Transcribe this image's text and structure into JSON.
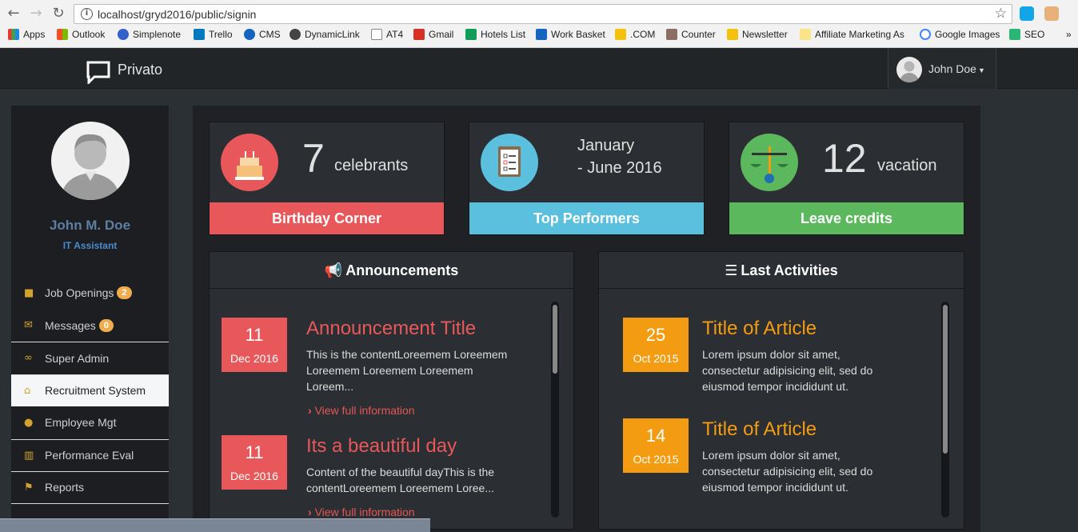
{
  "browser": {
    "url": "localhost/gryd2016/public/signin",
    "bookmarks": [
      "Apps",
      "Outlook",
      "Simplenote",
      "Trello",
      "CMS",
      "DynamicLink",
      "AT4",
      "Gmail",
      "Hotels List",
      "Work Basket",
      ".COM",
      "Counter",
      "Newsletter",
      "Affiliate Marketing As",
      "Google Images",
      "SEO"
    ],
    "overflow": "»"
  },
  "nav": {
    "brand": "Privato",
    "user": "John Doe"
  },
  "profile": {
    "name": "John M. Doe",
    "role": "IT Assistant"
  },
  "menu": [
    {
      "label": "Job Openings",
      "badge": "2",
      "icon": "briefcase-icon"
    },
    {
      "label": "Messages",
      "badge": "0",
      "icon": "envelope-icon"
    },
    {
      "label": "Super Admin",
      "icon": "glasses-icon"
    },
    {
      "label": "Recruitment System",
      "icon": "home-icon"
    },
    {
      "label": "Employee Mgt",
      "icon": "user-icon"
    },
    {
      "label": "Performance Eval",
      "icon": "bar-chart-icon"
    },
    {
      "label": "Reports",
      "icon": "flag-icon"
    }
  ],
  "cards": {
    "birthday": {
      "number": "7",
      "label": "celebrants",
      "title": "Birthday Corner",
      "color": "#e8585a",
      "icon": "cake-icon"
    },
    "performers": {
      "line1": "January",
      "line2": "- June 2016",
      "title": "Top Performers",
      "color": "#5bc0de",
      "icon": "clipboard-icon"
    },
    "leave": {
      "number": "12",
      "label": "vacation",
      "title": "Leave credits",
      "color": "#5cb85c",
      "icon": "scales-icon"
    }
  },
  "announcements": {
    "heading": "Announcements",
    "items": [
      {
        "day": "11",
        "month": "Dec 2016",
        "title": "Announcement Title",
        "body": "This is the contentLoreemem Loreemem Loreemem Loreemem Loreemem Loreem...",
        "link": "View full information"
      },
      {
        "day": "11",
        "month": "Dec 2016",
        "title": "Its a beautiful day",
        "body": "Content of the beautiful dayThis is the contentLoreemem Loreemem Loree...",
        "link": "View full information"
      }
    ]
  },
  "activities": {
    "heading": "Last Activities",
    "items": [
      {
        "day": "25",
        "month": "Oct 2015",
        "title": "Title of Article",
        "body": "Lorem ipsum dolor sit amet, consectetur adipisicing elit, sed do eiusmod tempor incididunt ut."
      },
      {
        "day": "14",
        "month": "Oct 2015",
        "title": "Title of Article",
        "body": "Lorem ipsum dolor sit amet, consectetur adipisicing elit, sed do eiusmod tempor incididunt ut."
      }
    ]
  },
  "colors": {
    "announce": "#e8585a",
    "activity": "#f39c12"
  }
}
